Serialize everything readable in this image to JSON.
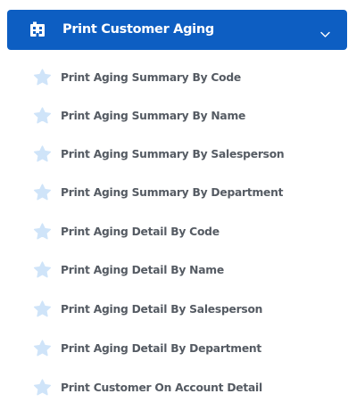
{
  "menu": {
    "title": "Print Customer Aging",
    "icon": "building-icon",
    "expand_icon": "chevron-down-icon",
    "colors": {
      "header_bg": "#0d5ec2",
      "header_text": "#ffffff",
      "item_text": "#555b63",
      "star": "#cfe4f9"
    },
    "items": [
      {
        "label": "Print Aging Summary By Code",
        "icon": "star-icon"
      },
      {
        "label": "Print Aging Summary By Name",
        "icon": "star-icon"
      },
      {
        "label": "Print Aging Summary By Salesperson",
        "icon": "star-icon"
      },
      {
        "label": "Print Aging Summary By Department",
        "icon": "star-icon"
      },
      {
        "label": "Print Aging Detail By Code",
        "icon": "star-icon"
      },
      {
        "label": "Print Aging Detail By Name",
        "icon": "star-icon"
      },
      {
        "label": "Print Aging Detail By Salesperson",
        "icon": "star-icon"
      },
      {
        "label": "Print Aging Detail By Department",
        "icon": "star-icon"
      },
      {
        "label": "Print Customer On Account Detail",
        "icon": "star-icon"
      }
    ]
  }
}
